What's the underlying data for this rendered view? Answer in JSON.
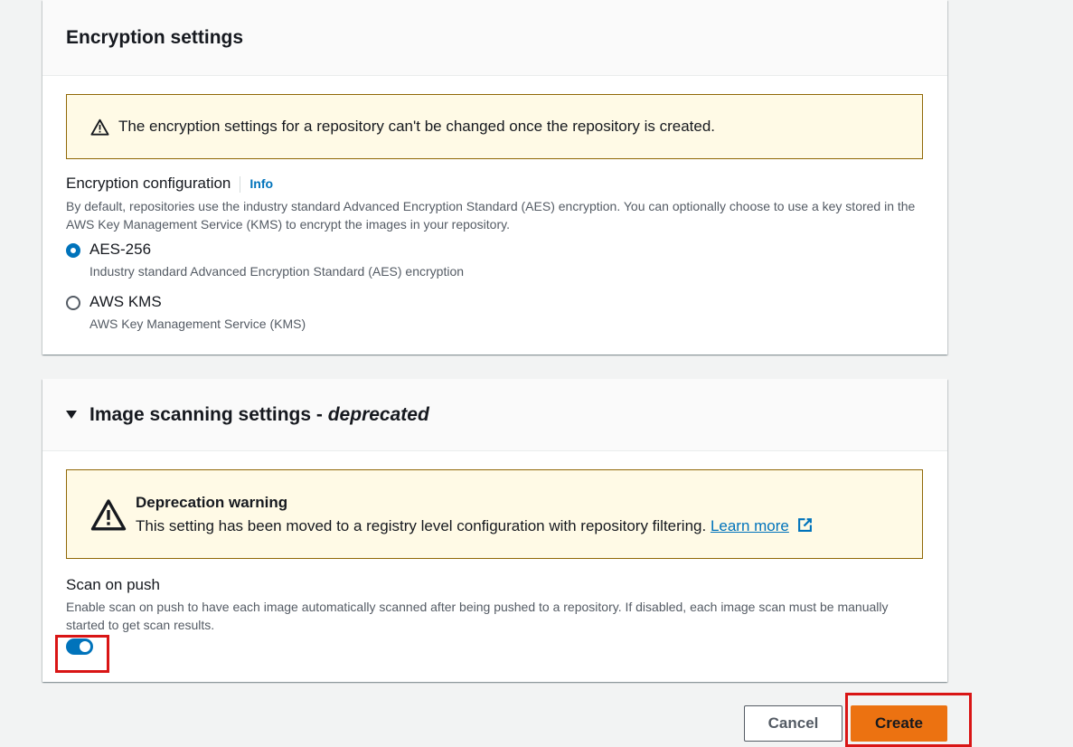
{
  "encryption": {
    "title": "Encryption settings",
    "alert": "The encryption settings for a repository can't be changed once the repository is created.",
    "config_label": "Encryption configuration",
    "info_link": "Info",
    "config_desc": "By default, repositories use the industry standard Advanced Encryption Standard (AES) encryption. You can optionally choose to use a key stored in the AWS Key Management Service (KMS) to encrypt the images in your repository.",
    "options": [
      {
        "label": "AES-256",
        "desc": "Industry standard Advanced Encryption Standard (AES) encryption",
        "selected": true
      },
      {
        "label": "AWS KMS",
        "desc": "AWS Key Management Service (KMS)",
        "selected": false
      }
    ]
  },
  "scanning": {
    "title": "Image scanning settings - ",
    "title_italic": "deprecated",
    "warning_title": "Deprecation warning",
    "warning_text": "This setting has been moved to a registry level configuration with repository filtering.",
    "learn_more": "Learn more",
    "scan_label": "Scan on push",
    "scan_desc": "Enable scan on push to have each image automatically scanned after being pushed to a repository. If disabled, each image scan must be manually started to get scan results.",
    "scan_enabled": true
  },
  "actions": {
    "cancel": "Cancel",
    "create": "Create"
  },
  "colors": {
    "primary": "#ec7211",
    "link": "#0073bb",
    "warning_bg": "#fffae6",
    "highlight": "#d91515"
  },
  "icons": [
    "warning-icon",
    "caret-down-icon",
    "external-link-icon"
  ]
}
